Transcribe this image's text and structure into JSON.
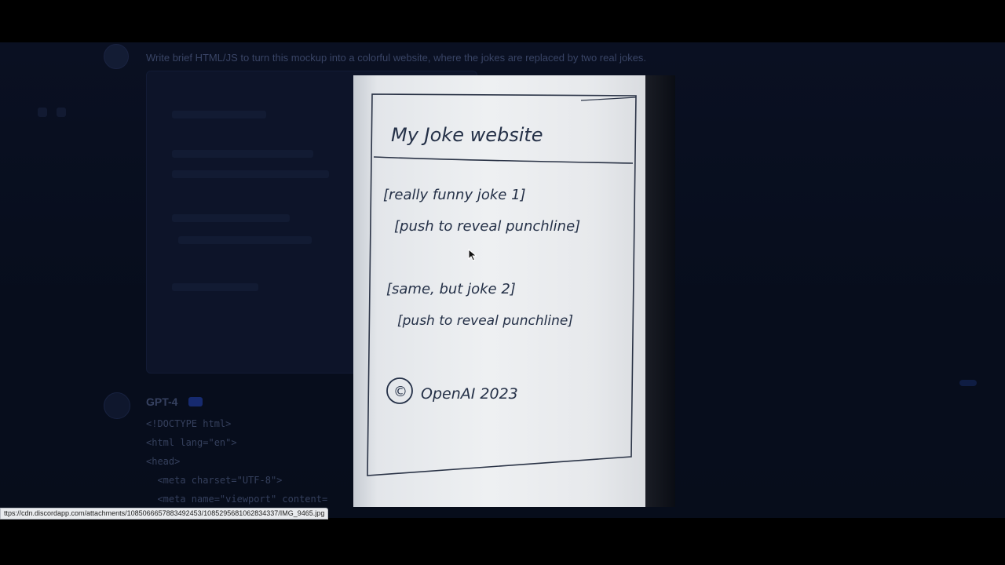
{
  "chat": {
    "user_message": "Write brief HTML/JS to turn this mockup into a colorful website, where the jokes are replaced by two real jokes.",
    "assistant": {
      "name": "GPT-4",
      "code_lines": [
        "<!DOCTYPE html>",
        "<html lang=\"en\">",
        "<head>",
        "  <meta charset=\"UTF-8\">",
        "  <meta name=\"viewport\" content="
      ]
    }
  },
  "sketch": {
    "title": "My Joke website",
    "joke1": "[really funny joke 1]",
    "button1": "[push to reveal punchline]",
    "joke2": "[same, but joke 2]",
    "button2": "[push to reveal punchline]",
    "footer": "OpenAI 2023",
    "footer_symbol": "©"
  },
  "status_bar": {
    "url": "ttps://cdn.discordapp.com/attachments/1085066657883492453/1085295681062834337/IMG_9465.jpg"
  },
  "colors": {
    "background": "#000000",
    "app_bg": "#0e1730",
    "paper": "#eef0f2",
    "ink": "#243047"
  }
}
